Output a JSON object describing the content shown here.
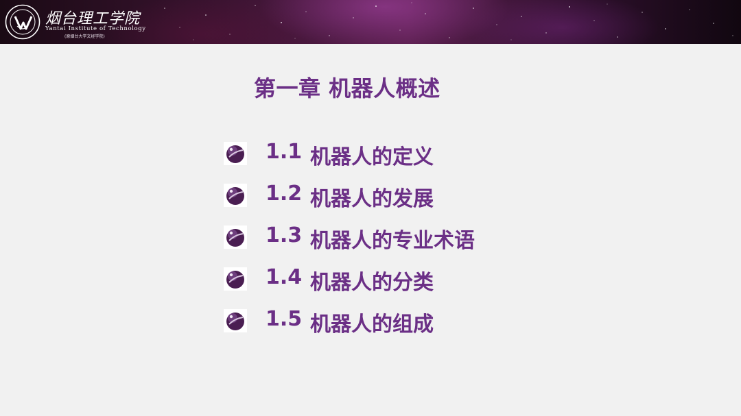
{
  "header": {
    "school_name_cn": "烟台理工学院",
    "school_name_en": "Yantai Institute of Technology",
    "school_subtitle": "(原烟台大学文经学院)"
  },
  "slide": {
    "title": "第一章 机器人概述",
    "items": [
      {
        "num": "1.1",
        "label": "机器人的定义"
      },
      {
        "num": "1.2",
        "label": "机器人的发展"
      },
      {
        "num": "1.3",
        "label": "机器人的专业术语"
      },
      {
        "num": "1.4",
        "label": "机器人的分类"
      },
      {
        "num": "1.5",
        "label": "机器人的组成"
      }
    ]
  },
  "colors": {
    "accent": "#6b2f86",
    "background": "#f1f1f1",
    "banner": "#3a1330"
  },
  "icons": {
    "bullet": "purple-sphere-bullet-icon",
    "logo": "school-emblem-icon"
  }
}
